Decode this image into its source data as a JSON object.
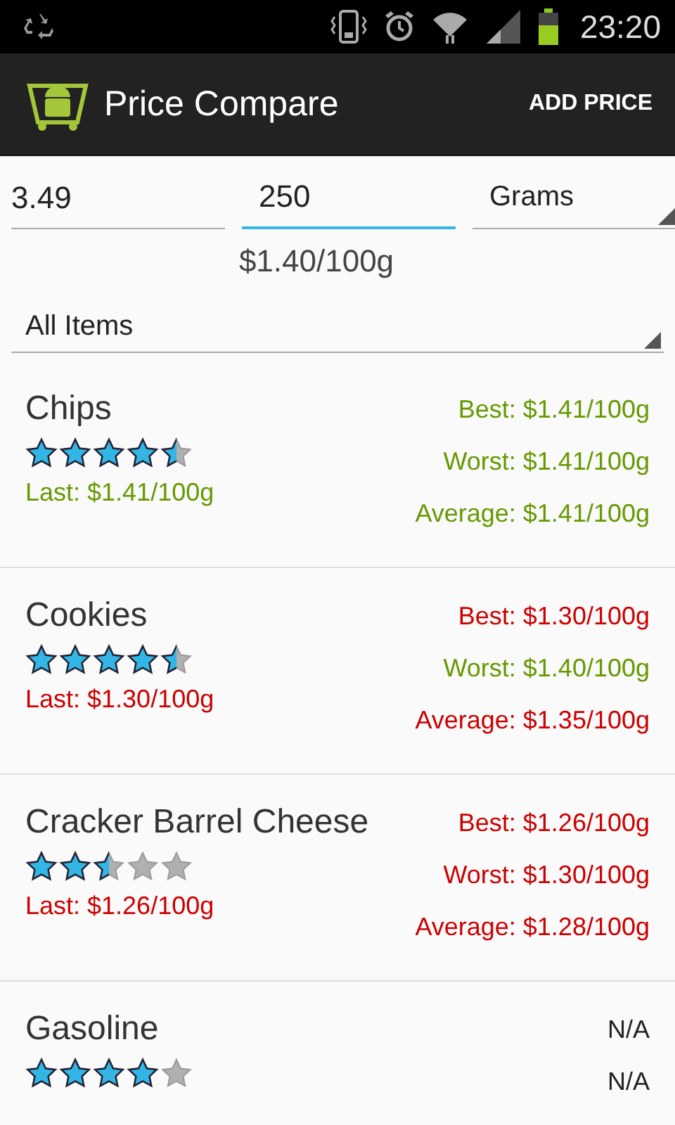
{
  "status_bar": {
    "time": "23:20"
  },
  "action_bar": {
    "title": "Price Compare",
    "action": "ADD PRICE"
  },
  "entry": {
    "fields": [
      {
        "value": "3.49",
        "focused": false
      },
      {
        "value": "250",
        "focused": true
      }
    ],
    "unit": "Grams",
    "rate": "$1.40/100g"
  },
  "filter": {
    "value": "All Items"
  },
  "items": [
    {
      "name": "Chips",
      "stars": 4.5,
      "last": {
        "text": "Last: $1.41/100g",
        "color": "#669900"
      },
      "stats": [
        {
          "text": "Best: $1.41/100g",
          "color": "#669900"
        },
        {
          "text": "Worst: $1.41/100g",
          "color": "#669900"
        },
        {
          "text": "Average: $1.41/100g",
          "color": "#669900"
        }
      ]
    },
    {
      "name": "Cookies",
      "stars": 4.5,
      "last": {
        "text": "Last: $1.30/100g",
        "color": "#cc0000"
      },
      "stats": [
        {
          "text": "Best: $1.30/100g",
          "color": "#cc0000"
        },
        {
          "text": "Worst: $1.40/100g",
          "color": "#669900"
        },
        {
          "text": "Average: $1.35/100g",
          "color": "#cc0000"
        }
      ]
    },
    {
      "name": "Cracker Barrel Cheese",
      "stars": 2.5,
      "last": {
        "text": "Last: $1.26/100g",
        "color": "#cc0000"
      },
      "stats": [
        {
          "text": "Best: $1.26/100g",
          "color": "#cc0000"
        },
        {
          "text": "Worst: $1.30/100g",
          "color": "#cc0000"
        },
        {
          "text": "Average: $1.28/100g",
          "color": "#cc0000"
        }
      ]
    },
    {
      "name": "Gasoline",
      "stars": 4,
      "stats": [
        {
          "text": "N/A",
          "color": "#222222"
        },
        {
          "text": "N/A",
          "color": "#222222"
        }
      ]
    }
  ]
}
